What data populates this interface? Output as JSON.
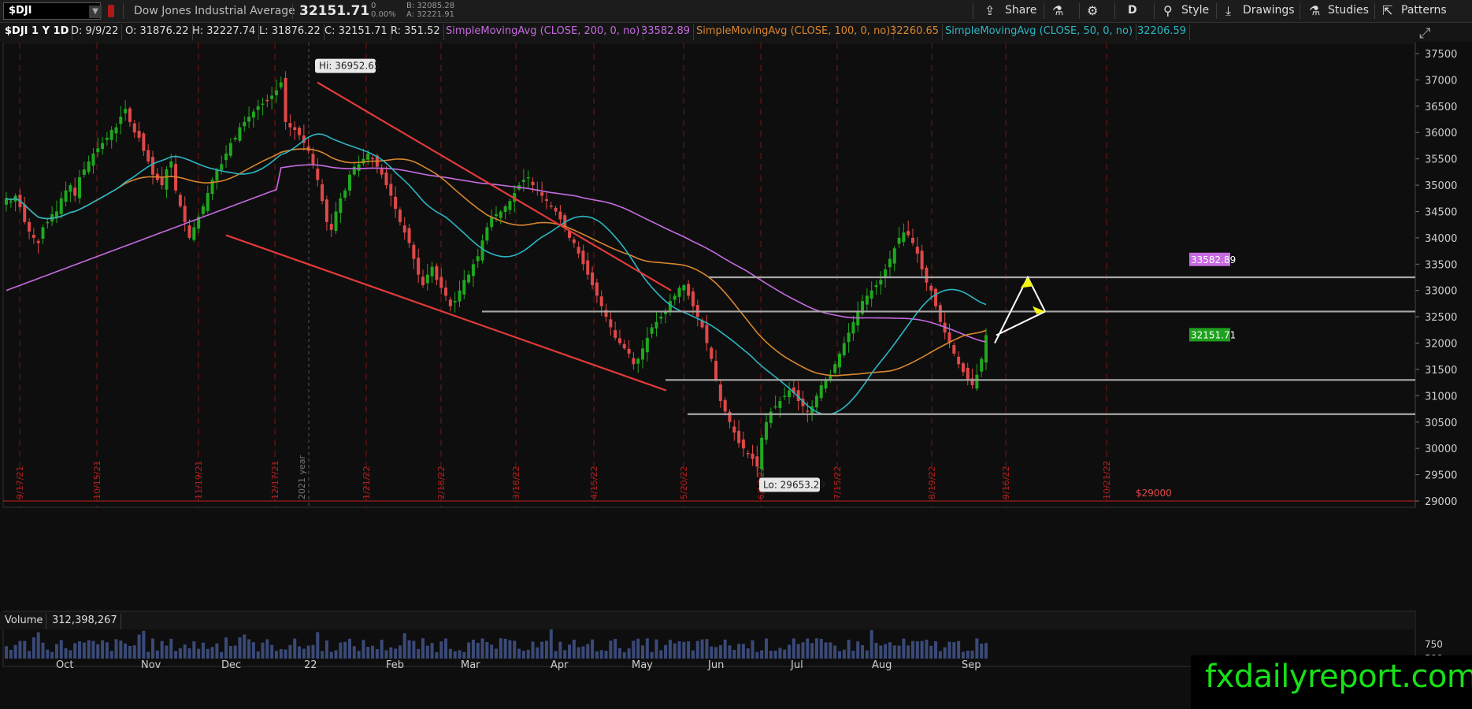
{
  "toolbar": {
    "symbol": "$DJI",
    "description": "Dow Jones Industrial Average",
    "last": "32151.71",
    "change_top": "0",
    "change_pct": "0.00%",
    "bid": "B: 32085.28",
    "ask": "A: 32221.91",
    "share": "Share",
    "day": "D",
    "style": "Style",
    "drawings": "Drawings",
    "studies": "Studies",
    "patterns": "Patterns"
  },
  "info": {
    "label": "$DJI 1 Y 1D",
    "date": "D: 9/9/22",
    "open": "O: 31876.22",
    "high": "H: 32227.74",
    "low": "L: 31876.22",
    "close": "C: 32151.71",
    "range": "R: 351.52",
    "sma200": "SimpleMovingAvg (CLOSE, 200, 0, no)",
    "sma200_val": "33582.89",
    "sma100": "SimpleMovingAvg (CLOSE, 100, 0, no)",
    "sma100_val": "32260.65",
    "sma50": "SimpleMovingAvg (CLOSE, 50, 0, no)",
    "sma50_val": "32206.59"
  },
  "volume": {
    "label": "Volume",
    "value": "312,398,267"
  },
  "watermark": "fxdailyreport.com",
  "colors": {
    "up": "#1fa81f",
    "down": "#e04848",
    "sma200": "#c66be0",
    "sma100": "#d9862e",
    "sma50": "#2bb6c4",
    "trend": "#e23a3a",
    "level": "#a8a8a8",
    "vline": "#7a1414"
  },
  "chart_data": {
    "type": "candlestick",
    "ylim": [
      28800,
      37800
    ],
    "y_ticks": [
      "37500",
      "37000",
      "36500",
      "36000",
      "35500",
      "35000",
      "34500",
      "34000",
      "33500",
      "33000",
      "32500",
      "32000",
      "31500",
      "31000",
      "30500",
      "30000",
      "29500",
      "29000"
    ],
    "x_labels": [
      "Oct",
      "Nov",
      "Dec",
      "22",
      "Feb",
      "Mar",
      "Apr",
      "May",
      "Jun",
      "Jul",
      "Aug",
      "Sep"
    ],
    "date_markers": [
      "9/17/21",
      "10/15/21",
      "11/19/21",
      "12/17/21",
      "1/21/22",
      "2/18/22",
      "3/18/22",
      "4/15/22",
      "5/20/22",
      "6/17/22",
      "7/15/22",
      "8/19/22",
      "9/16/22",
      "10/21/22"
    ],
    "year_marker": "2021 year",
    "hi_label": "Hi: 36952.65",
    "lo_label": "Lo: 29653.29",
    "last_label": "32151.71",
    "sma200_label": "33582.89",
    "floor_label": "$29000",
    "closes": [
      34750,
      34690,
      34800,
      34580,
      34300,
      34120,
      34000,
      33900,
      34200,
      34300,
      34450,
      34500,
      34750,
      34900,
      35000,
      34800,
      35150,
      35300,
      35450,
      35600,
      35700,
      35800,
      35900,
      36050,
      36100,
      36300,
      36450,
      36200,
      36000,
      35900,
      35650,
      35450,
      35200,
      35100,
      35000,
      35300,
      35450,
      34900,
      34600,
      34300,
      34000,
      34200,
      34400,
      34600,
      34850,
      35100,
      35300,
      35400,
      35600,
      35800,
      35900,
      36100,
      36200,
      36300,
      36400,
      36500,
      36550,
      36600,
      36700,
      36800,
      36952,
      36200,
      36100,
      36050,
      35950,
      35800,
      35650,
      35400,
      35100,
      34700,
      34300,
      34150,
      34500,
      34750,
      34900,
      35200,
      35350,
      35400,
      35500,
      35600,
      35500,
      35350,
      35200,
      35000,
      34800,
      34550,
      34300,
      34100,
      33900,
      33600,
      33300,
      33100,
      33300,
      33450,
      33200,
      33050,
      32900,
      32700,
      32800,
      33000,
      33200,
      33300,
      33500,
      33650,
      33950,
      34200,
      34400,
      34450,
      34500,
      34600,
      34700,
      34850,
      35000,
      35100,
      35150,
      35000,
      34900,
      34800,
      34700,
      34600,
      34500,
      34350,
      34200,
      34000,
      33900,
      33700,
      33500,
      33300,
      33100,
      32900,
      32700,
      32500,
      32300,
      32100,
      32000,
      31900,
      31800,
      31600,
      31700,
      31900,
      32100,
      32300,
      32400,
      32500,
      32600,
      32800,
      32900,
      33050,
      33100,
      32900,
      32700,
      32500,
      32300,
      32000,
      31700,
      31300,
      30900,
      30700,
      30500,
      30300,
      30100,
      30000,
      29900,
      29800,
      29653,
      30200,
      30500,
      30700,
      30800,
      30900,
      31000,
      31100,
      31050,
      30900,
      30800,
      30700,
      30800,
      31000,
      31200,
      31300,
      31400,
      31600,
      31800,
      32000,
      32200,
      32400,
      32600,
      32800,
      32900,
      33000,
      33100,
      33200,
      33400,
      33600,
      33800,
      34000,
      34100,
      34050,
      33900,
      33700,
      33400,
      33150,
      33000,
      32700,
      32400,
      32200,
      32000,
      31800,
      31600,
      31450,
      31300,
      31200,
      31400,
      31700,
      32151
    ]
  }
}
